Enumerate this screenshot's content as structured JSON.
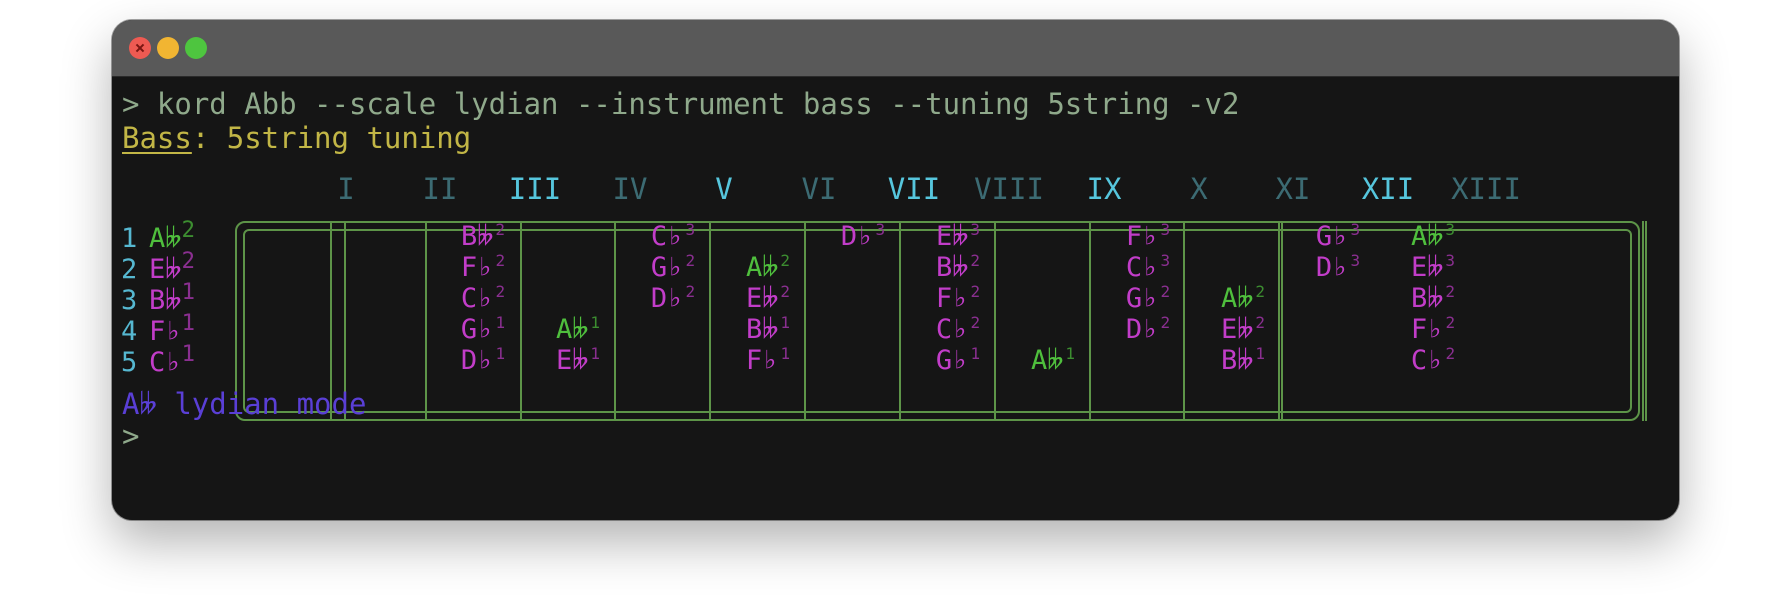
{
  "window": {
    "controls": [
      "close",
      "minimize",
      "zoom"
    ]
  },
  "terminal": {
    "command_line": "> kord Abb --scale lydian --instrument bass --tuning 5string -v2",
    "instrument_label": "Bass",
    "tuning_text": ": 5string tuning",
    "mode_line": "A𝄫 lydian mode",
    "final_prompt": ">"
  },
  "fretboard": {
    "fret_numerals": [
      {
        "label": "I",
        "bright": false
      },
      {
        "label": "II",
        "bright": false
      },
      {
        "label": "III",
        "bright": true
      },
      {
        "label": "IV",
        "bright": false
      },
      {
        "label": "V",
        "bright": true
      },
      {
        "label": "VI",
        "bright": false
      },
      {
        "label": "VII",
        "bright": true
      },
      {
        "label": "VIII",
        "bright": false
      },
      {
        "label": "IX",
        "bright": true
      },
      {
        "label": "X",
        "bright": false
      },
      {
        "label": "XI",
        "bright": false
      },
      {
        "label": "XII",
        "bright": true
      },
      {
        "label": "XIII",
        "bright": false
      }
    ],
    "strings": [
      {
        "number": "1",
        "open": {
          "note": "A𝄫",
          "octave": "2",
          "root": true
        }
      },
      {
        "number": "2",
        "open": {
          "note": "E𝄫",
          "octave": "2",
          "root": false
        }
      },
      {
        "number": "3",
        "open": {
          "note": "B𝄫",
          "octave": "1",
          "root": false
        }
      },
      {
        "number": "4",
        "open": {
          "note": "F♭",
          "octave": "1",
          "root": false
        }
      },
      {
        "number": "5",
        "open": {
          "note": "C♭",
          "octave": "1",
          "root": false
        }
      }
    ],
    "notes": [
      {
        "string": 1,
        "fret": 2,
        "note": "B𝄫",
        "octave": "2",
        "root": false
      },
      {
        "string": 1,
        "fret": 4,
        "note": "C♭",
        "octave": "3",
        "root": false
      },
      {
        "string": 1,
        "fret": 6,
        "note": "D♭",
        "octave": "3",
        "root": false
      },
      {
        "string": 1,
        "fret": 7,
        "note": "E𝄫",
        "octave": "3",
        "root": false
      },
      {
        "string": 1,
        "fret": 9,
        "note": "F♭",
        "octave": "3",
        "root": false
      },
      {
        "string": 1,
        "fret": 11,
        "note": "G♭",
        "octave": "3",
        "root": false
      },
      {
        "string": 1,
        "fret": 12,
        "note": "A𝄫",
        "octave": "3",
        "root": true
      },
      {
        "string": 2,
        "fret": 2,
        "note": "F♭",
        "octave": "2",
        "root": false
      },
      {
        "string": 2,
        "fret": 4,
        "note": "G♭",
        "octave": "2",
        "root": false
      },
      {
        "string": 2,
        "fret": 5,
        "note": "A𝄫",
        "octave": "2",
        "root": true
      },
      {
        "string": 2,
        "fret": 7,
        "note": "B𝄫",
        "octave": "2",
        "root": false
      },
      {
        "string": 2,
        "fret": 9,
        "note": "C♭",
        "octave": "3",
        "root": false
      },
      {
        "string": 2,
        "fret": 11,
        "note": "D♭",
        "octave": "3",
        "root": false
      },
      {
        "string": 2,
        "fret": 12,
        "note": "E𝄫",
        "octave": "3",
        "root": false
      },
      {
        "string": 3,
        "fret": 2,
        "note": "C♭",
        "octave": "2",
        "root": false
      },
      {
        "string": 3,
        "fret": 4,
        "note": "D♭",
        "octave": "2",
        "root": false
      },
      {
        "string": 3,
        "fret": 5,
        "note": "E𝄫",
        "octave": "2",
        "root": false
      },
      {
        "string": 3,
        "fret": 7,
        "note": "F♭",
        "octave": "2",
        "root": false
      },
      {
        "string": 3,
        "fret": 9,
        "note": "G♭",
        "octave": "2",
        "root": false
      },
      {
        "string": 3,
        "fret": 10,
        "note": "A𝄫",
        "octave": "2",
        "root": true
      },
      {
        "string": 3,
        "fret": 12,
        "note": "B𝄫",
        "octave": "2",
        "root": false
      },
      {
        "string": 4,
        "fret": 2,
        "note": "G♭",
        "octave": "1",
        "root": false
      },
      {
        "string": 4,
        "fret": 3,
        "note": "A𝄫",
        "octave": "1",
        "root": true
      },
      {
        "string": 4,
        "fret": 5,
        "note": "B𝄫",
        "octave": "1",
        "root": false
      },
      {
        "string": 4,
        "fret": 7,
        "note": "C♭",
        "octave": "2",
        "root": false
      },
      {
        "string": 4,
        "fret": 9,
        "note": "D♭",
        "octave": "2",
        "root": false
      },
      {
        "string": 4,
        "fret": 10,
        "note": "E𝄫",
        "octave": "2",
        "root": false
      },
      {
        "string": 4,
        "fret": 12,
        "note": "F♭",
        "octave": "2",
        "root": false
      },
      {
        "string": 5,
        "fret": 2,
        "note": "D♭",
        "octave": "1",
        "root": false
      },
      {
        "string": 5,
        "fret": 3,
        "note": "E𝄫",
        "octave": "1",
        "root": false
      },
      {
        "string": 5,
        "fret": 5,
        "note": "F♭",
        "octave": "1",
        "root": false
      },
      {
        "string": 5,
        "fret": 7,
        "note": "G♭",
        "octave": "1",
        "root": false
      },
      {
        "string": 5,
        "fret": 8,
        "note": "A𝄫",
        "octave": "1",
        "root": true
      },
      {
        "string": 5,
        "fret": 10,
        "note": "B𝄫",
        "octave": "1",
        "root": false
      },
      {
        "string": 5,
        "fret": 12,
        "note": "C♭",
        "octave": "2",
        "root": false
      }
    ]
  },
  "colors": {
    "root_note": "#4fbf3d",
    "scale_note": "#c23dc9",
    "fret_lines": "#5d9448",
    "command_text": "#8fa98b",
    "tuning_text": "#c2b646",
    "mode_text": "#5a3fd6"
  }
}
